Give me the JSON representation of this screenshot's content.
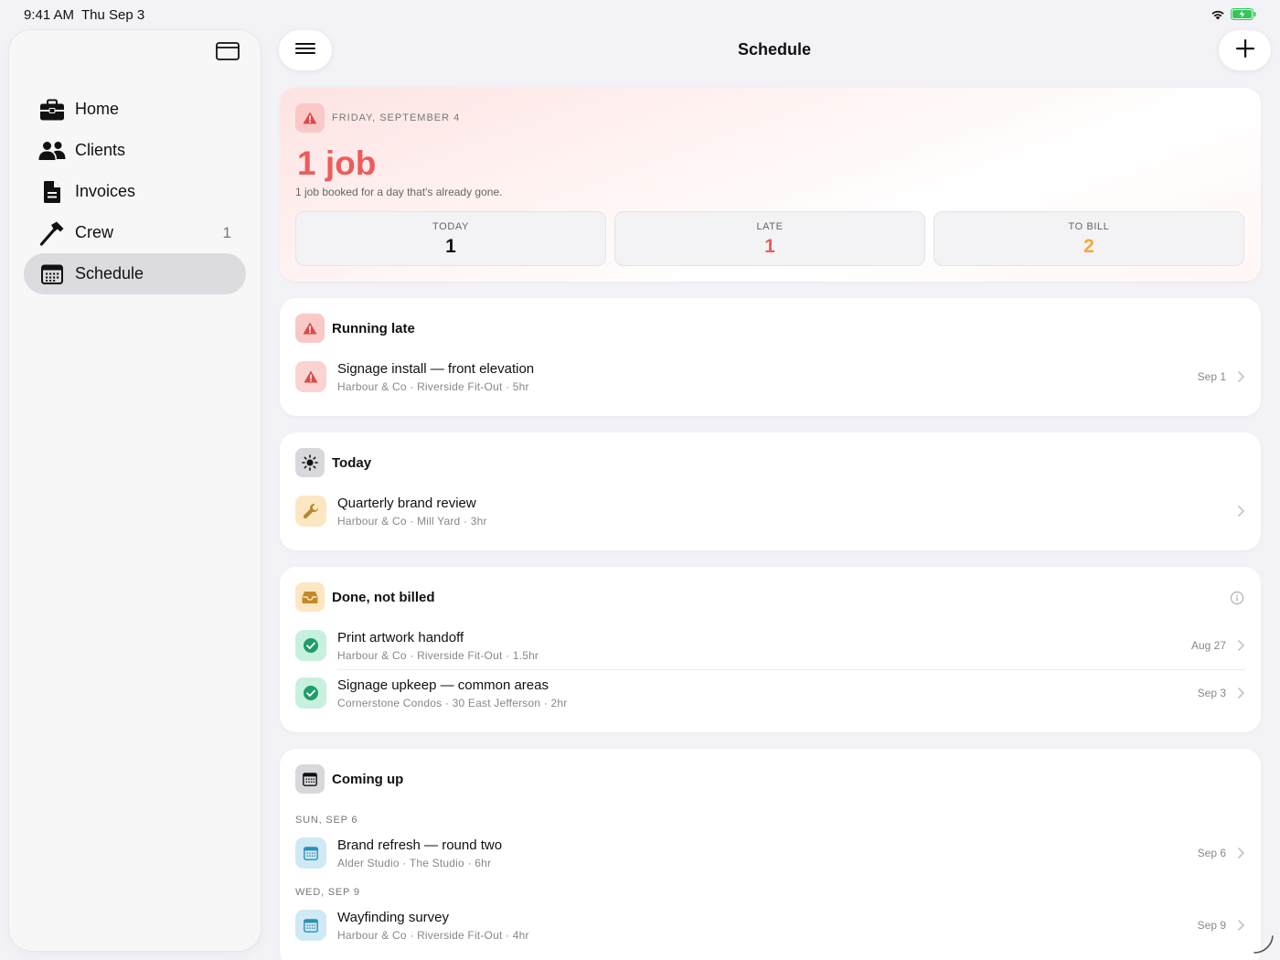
{
  "status_bar": {
    "time": "9:41 AM",
    "date": "Thu Sep 3"
  },
  "sidebar": {
    "items": [
      {
        "label": "Home",
        "icon": "briefcase-icon"
      },
      {
        "label": "Clients",
        "icon": "people-icon"
      },
      {
        "label": "Invoices",
        "icon": "document-icon"
      },
      {
        "label": "Crew",
        "icon": "hammer-icon",
        "count": "1"
      },
      {
        "label": "Schedule",
        "icon": "calendar-icon",
        "active": true
      }
    ]
  },
  "header": {
    "title": "Schedule"
  },
  "hero": {
    "date": "FRIDAY, SEPTEMBER 4",
    "title": "1 job",
    "subtitle": "1 job booked for a day that's already gone.",
    "stats": [
      {
        "label": "TODAY",
        "value": "1",
        "color": "#111111"
      },
      {
        "label": "LATE",
        "value": "1",
        "color": "#ef5b5b"
      },
      {
        "label": "TO BILL",
        "value": "2",
        "color": "#f2a93b"
      }
    ]
  },
  "sections": {
    "running_late": {
      "title": "Running late",
      "rows": [
        {
          "title": "Signage install — front elevation",
          "client": "Harbour & Co",
          "site": "Riverside Fit-Out",
          "duration": "5hr",
          "date": "Sep 1"
        }
      ]
    },
    "today": {
      "title": "Today",
      "rows": [
        {
          "title": "Quarterly brand review",
          "client": "Harbour & Co",
          "site": "Mill Yard",
          "duration": "3hr",
          "date": ""
        }
      ]
    },
    "done_not_billed": {
      "title": "Done, not billed",
      "rows": [
        {
          "title": "Print artwork handoff",
          "client": "Harbour & Co",
          "site": "Riverside Fit-Out",
          "duration": "1.5hr",
          "date": "Aug 27"
        },
        {
          "title": "Signage upkeep — common areas",
          "client": "Cornerstone Condos",
          "site": "30 East Jefferson",
          "duration": "2hr",
          "date": "Sep 3"
        }
      ]
    },
    "coming_up": {
      "title": "Coming up",
      "groups": [
        {
          "label": "SUN, SEP 6",
          "row": {
            "title": "Brand refresh — round two",
            "client": "Alder Studio",
            "site": "The Studio",
            "duration": "6hr",
            "date": "Sep 6"
          }
        },
        {
          "label": "WED, SEP 9",
          "row": {
            "title": "Wayfinding survey",
            "client": "Harbour & Co",
            "site": "Riverside Fit-Out",
            "duration": "4hr",
            "date": "Sep 9"
          }
        }
      ]
    }
  },
  "separator": "·",
  "colors": {
    "late": "#ef5b5b",
    "bill": "#f2a93b",
    "done": "#1f9d6b",
    "accent_blue": "#2a8fb8"
  }
}
